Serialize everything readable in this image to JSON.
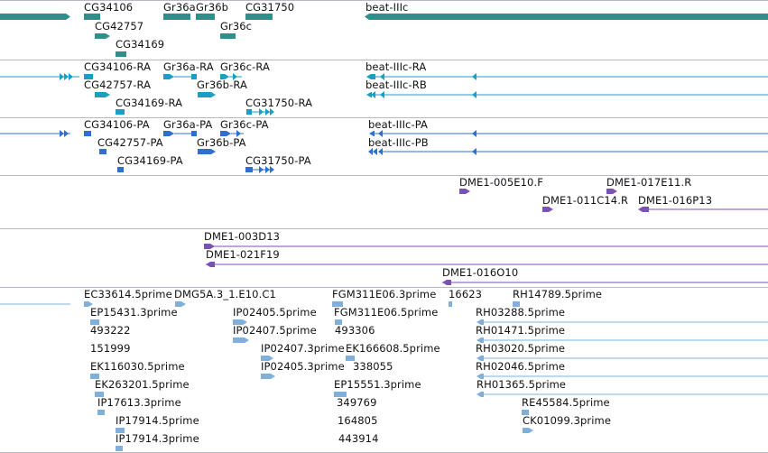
{
  "tracks": {
    "genes": {
      "color": "#2f8f8a",
      "labels": [
        "CG34106",
        "Gr36a",
        "Gr36b",
        "CG31750",
        "beat-IIIc",
        "CG42757",
        "Gr36c",
        "CG34169"
      ]
    },
    "transcripts": {
      "color": "#1a9fc4",
      "labels": [
        "CG34106-RA",
        "Gr36a-RA",
        "Gr36c-RA",
        "beat-IIIc-RA",
        "CG42757-RA",
        "Gr36b-RA",
        "beat-IIIc-RB",
        "CG34169-RA",
        "CG31750-RA"
      ]
    },
    "proteins": {
      "color": "#2f6fd0",
      "labels": [
        "CG34106-PA",
        "Gr36a-PA",
        "Gr36c-PA",
        "beat-IIIc-PA",
        "CG42757-PA",
        "Gr36b-PA",
        "beat-IIIc-PB",
        "CG34169-PA",
        "CG31750-PA"
      ]
    },
    "bac_ends": {
      "color": "#7a52b3",
      "labels": [
        "DME1-005E10.F",
        "DME1-017E11.R",
        "DME1-011C14.R",
        "DME1-016P13"
      ]
    },
    "bac_clones": {
      "color": "#7a52b3",
      "labels": [
        "DME1-003D13",
        "DME1-021F19",
        "DME1-016O10"
      ]
    },
    "ests": {
      "color": "#7fb0dc",
      "labels": [
        "EC33614.5prime",
        "DMG5A.3_1.E10.C1",
        "FGM311E06.3prime",
        "16623",
        "RH14789.5prime",
        "EP15431.3prime",
        "IP02405.5prime",
        "FGM311E06.5prime",
        "RH03288.5prime",
        "493222",
        "IP02407.5prime",
        "493306",
        "RH01471.5prime",
        "151999",
        "IP02407.3prime",
        "EK166608.5prime",
        "RH03020.5prime",
        "EK116030.5prime",
        "IP02405.3prime",
        "338055",
        "RH02046.5prime",
        "EK263201.5prime",
        "EP15551.3prime",
        "RH01365.5prime",
        "IP17613.3prime",
        "349769",
        "RE45584.5prime",
        "IP17914.5prime",
        "164805",
        "CK01099.3prime",
        "IP17914.3prime",
        "443914"
      ]
    }
  }
}
